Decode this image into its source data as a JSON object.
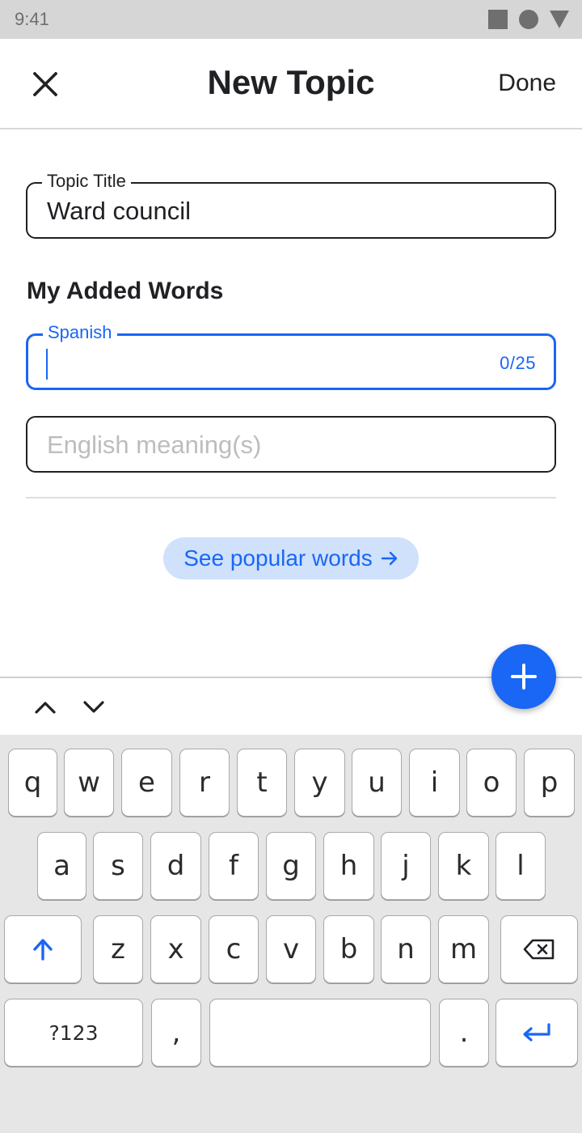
{
  "status_bar": {
    "time": "9:41"
  },
  "app_bar": {
    "title": "New Topic",
    "done_label": "Done"
  },
  "topic_title_field": {
    "label": "Topic Title",
    "value": "Ward council"
  },
  "section_title": "My Added Words",
  "spanish_field": {
    "label": "Spanish",
    "value": "",
    "counter": "0/25"
  },
  "english_field": {
    "placeholder": "English meaning(s)"
  },
  "popular_chip": {
    "label": "See popular words",
    "arrow": "→"
  },
  "colors": {
    "accent": "#1a66f5",
    "chip_bg": "#cfe1fb",
    "keyboard_bg": "#e6e6e6"
  },
  "keyboard": {
    "row1": [
      "q",
      "w",
      "e",
      "r",
      "t",
      "y",
      "u",
      "i",
      "o",
      "p"
    ],
    "row2": [
      "a",
      "s",
      "d",
      "f",
      "g",
      "h",
      "j",
      "k",
      "l"
    ],
    "row3": [
      "z",
      "x",
      "c",
      "v",
      "b",
      "n",
      "m"
    ],
    "symbols_label": "?123",
    "comma": ",",
    "period": "."
  },
  "icons": [
    "close-icon",
    "plus-icon",
    "chevron-up-icon",
    "chevron-down-icon",
    "shift-icon",
    "backspace-icon",
    "enter-icon"
  ]
}
